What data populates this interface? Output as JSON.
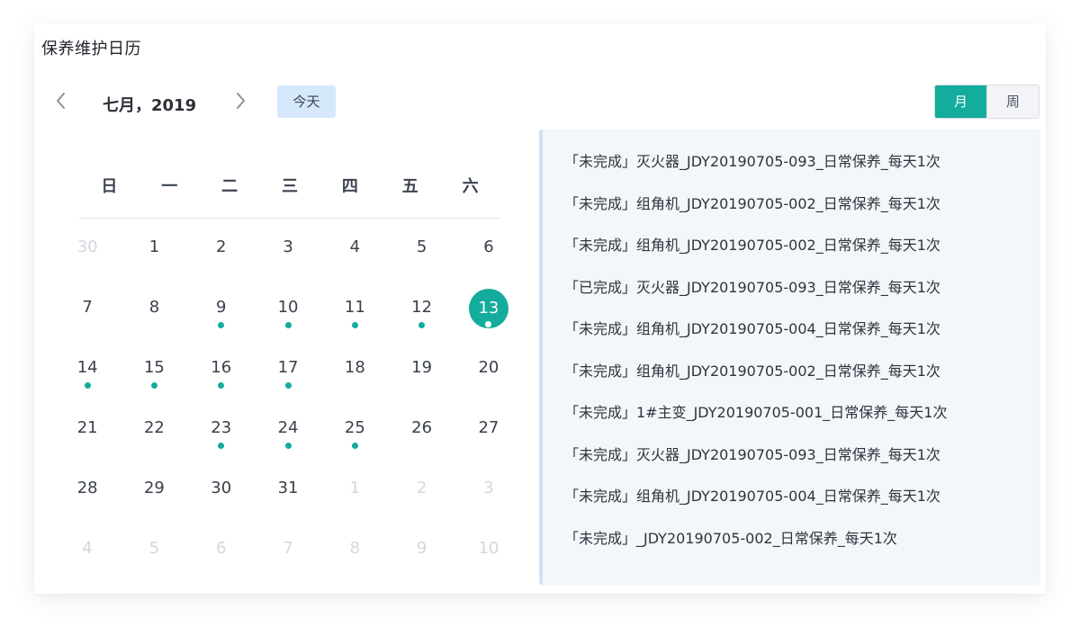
{
  "panel": {
    "title": "保养维护日历"
  },
  "header": {
    "month_label": "七月，2019",
    "prev_icon": "chevron-left-icon",
    "next_icon": "chevron-right-icon",
    "today_label": "今天"
  },
  "view_toggle": {
    "month_label": "月",
    "week_label": "周",
    "active": "月"
  },
  "colors": {
    "accent": "#13ac9d",
    "today_bg": "#d6e8fb",
    "panel_bg": "#f3f6fa",
    "muted_day": "#d3d7de"
  },
  "weekdays": [
    "日",
    "一",
    "二",
    "三",
    "四",
    "五",
    "六"
  ],
  "days": [
    {
      "label": "30",
      "muted": true,
      "dot": false
    },
    {
      "label": "1",
      "muted": false,
      "dot": false
    },
    {
      "label": "2",
      "muted": false,
      "dot": false
    },
    {
      "label": "3",
      "muted": false,
      "dot": false
    },
    {
      "label": "4",
      "muted": false,
      "dot": false
    },
    {
      "label": "5",
      "muted": false,
      "dot": false
    },
    {
      "label": "6",
      "muted": false,
      "dot": false
    },
    {
      "label": "7",
      "muted": false,
      "dot": false
    },
    {
      "label": "8",
      "muted": false,
      "dot": false
    },
    {
      "label": "9",
      "muted": false,
      "dot": true
    },
    {
      "label": "10",
      "muted": false,
      "dot": true
    },
    {
      "label": "11",
      "muted": false,
      "dot": true
    },
    {
      "label": "12",
      "muted": false,
      "dot": true
    },
    {
      "label": "13",
      "muted": false,
      "dot": true,
      "selected": true
    },
    {
      "label": "14",
      "muted": false,
      "dot": true
    },
    {
      "label": "15",
      "muted": false,
      "dot": true
    },
    {
      "label": "16",
      "muted": false,
      "dot": true
    },
    {
      "label": "17",
      "muted": false,
      "dot": true
    },
    {
      "label": "18",
      "muted": false,
      "dot": false
    },
    {
      "label": "19",
      "muted": false,
      "dot": false
    },
    {
      "label": "20",
      "muted": false,
      "dot": false
    },
    {
      "label": "21",
      "muted": false,
      "dot": false
    },
    {
      "label": "22",
      "muted": false,
      "dot": false
    },
    {
      "label": "23",
      "muted": false,
      "dot": true
    },
    {
      "label": "24",
      "muted": false,
      "dot": true
    },
    {
      "label": "25",
      "muted": false,
      "dot": true
    },
    {
      "label": "26",
      "muted": false,
      "dot": false
    },
    {
      "label": "27",
      "muted": false,
      "dot": false
    },
    {
      "label": "28",
      "muted": false,
      "dot": false
    },
    {
      "label": "29",
      "muted": false,
      "dot": false
    },
    {
      "label": "30",
      "muted": false,
      "dot": false
    },
    {
      "label": "31",
      "muted": false,
      "dot": false
    },
    {
      "label": "1",
      "muted": true,
      "dot": false
    },
    {
      "label": "2",
      "muted": true,
      "dot": false
    },
    {
      "label": "3",
      "muted": true,
      "dot": false
    },
    {
      "label": "4",
      "muted": true,
      "dot": false
    },
    {
      "label": "5",
      "muted": true,
      "dot": false
    },
    {
      "label": "6",
      "muted": true,
      "dot": false
    },
    {
      "label": "7",
      "muted": true,
      "dot": false
    },
    {
      "label": "8",
      "muted": true,
      "dot": false
    },
    {
      "label": "9",
      "muted": true,
      "dot": false
    },
    {
      "label": "10",
      "muted": true,
      "dot": false
    }
  ],
  "tasks": [
    "「未完成」灭火器_JDY20190705-093_日常保养_每天1次",
    "「未完成」组角机_JDY20190705-002_日常保养_每天1次",
    "「未完成」组角机_JDY20190705-002_日常保养_每天1次",
    "「已完成」灭火器_JDY20190705-093_日常保养_每天1次",
    "「未完成」组角机_JDY20190705-004_日常保养_每天1次",
    "「未完成」组角机_JDY20190705-002_日常保养_每天1次",
    "「未完成」1#主变_JDY20190705-001_日常保养_每天1次",
    "「未完成」灭火器_JDY20190705-093_日常保养_每天1次",
    "「未完成」组角机_JDY20190705-004_日常保养_每天1次",
    "「未完成」_JDY20190705-002_日常保养_每天1次"
  ]
}
